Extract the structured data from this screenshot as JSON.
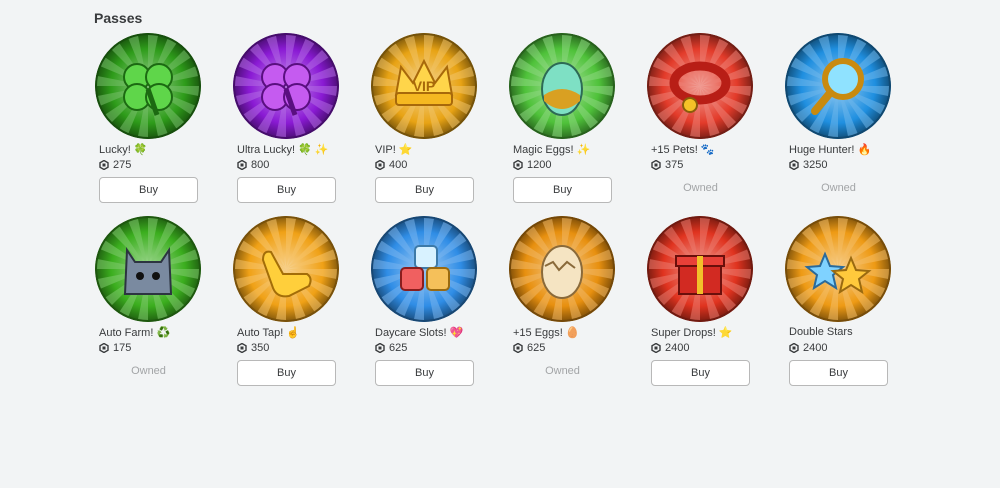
{
  "section_title": "Passes",
  "buy_label": "Buy",
  "owned_label": "Owned",
  "passes": [
    {
      "name": "Lucky! 🍀",
      "price": "275",
      "status": "buy",
      "icon": "clover-icon",
      "color": "#2e9c1a"
    },
    {
      "name": "Ultra Lucky! 🍀 ✨",
      "price": "800",
      "status": "buy",
      "icon": "purple-clover-icon",
      "color": "#8a1ad4"
    },
    {
      "name": "VIP! ⭐",
      "price": "400",
      "status": "buy",
      "icon": "vip-crown-icon",
      "color": "#e8a314"
    },
    {
      "name": "Magic Eggs! ✨",
      "price": "1200",
      "status": "buy",
      "icon": "rainbow-egg-icon",
      "color": "#4fc23a"
    },
    {
      "name": "+15 Pets! 🐾",
      "price": "375",
      "status": "owned",
      "icon": "pet-collar-icon",
      "color": "#e33b2a"
    },
    {
      "name": "Huge Hunter! 🔥",
      "price": "3250",
      "status": "owned",
      "icon": "magnifier-icon",
      "color": "#1f8fe0"
    },
    {
      "name": "Auto Farm! ♻️",
      "price": "175",
      "status": "owned",
      "icon": "cat-robot-icon",
      "color": "#3bae1e"
    },
    {
      "name": "Auto Tap! ☝️",
      "price": "350",
      "status": "buy",
      "icon": "tapping-hand-icon",
      "color": "#f0a116"
    },
    {
      "name": "Daycare Slots! 💖",
      "price": "625",
      "status": "buy",
      "icon": "dice-blocks-icon",
      "color": "#2f8de6"
    },
    {
      "name": "+15 Eggs! 🥚",
      "price": "625",
      "status": "owned",
      "icon": "cracked-egg-icon",
      "color": "#e8900f"
    },
    {
      "name": "Super Drops! ⭐",
      "price": "2400",
      "status": "buy",
      "icon": "gift-box-icon",
      "color": "#e0331f"
    },
    {
      "name": "Double Stars",
      "price": "2400",
      "status": "buy",
      "icon": "double-star-icon",
      "color": "#ee9a14"
    }
  ]
}
